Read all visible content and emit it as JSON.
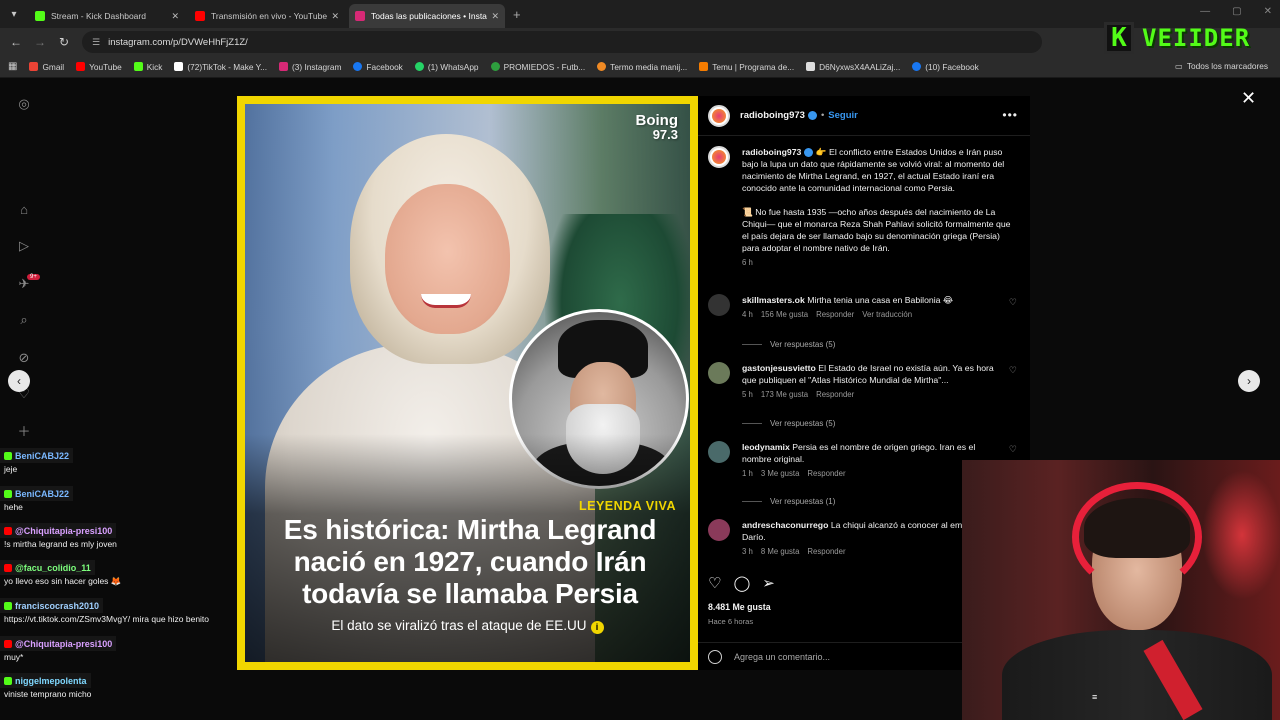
{
  "browser": {
    "tabs": [
      {
        "title": "Stream - Kick Dashboard",
        "color": "#53fc18",
        "active": false
      },
      {
        "title": "Transmisión en vivo - YouTube",
        "color": "#ff0000",
        "active": false
      },
      {
        "title": "Todas las publicaciones • Instag",
        "color": "#d62976",
        "active": true
      }
    ],
    "url": "instagram.com/p/DVWeHhFjZ1Z/",
    "bookmarks": [
      {
        "label": "Gmail",
        "color": "#ea4335"
      },
      {
        "label": "YouTube",
        "color": "#ff0000"
      },
      {
        "label": "Kick",
        "color": "#53fc18"
      },
      {
        "label": "(72)TikTok - Make Y...",
        "color": "#ffffff"
      },
      {
        "label": "(3) Instagram",
        "color": "#d62976"
      },
      {
        "label": "Facebook",
        "color": "#1877f2"
      },
      {
        "label": "(1) WhatsApp",
        "color": "#25d366"
      },
      {
        "label": "PROMIEDOS - Futb...",
        "color": "#2e9e3e"
      },
      {
        "label": "Termo media manij...",
        "color": "#f08a24"
      },
      {
        "label": "Temu | Programa de...",
        "color": "#f57c00"
      },
      {
        "label": "D6NyxwsX4AALiZaj...",
        "color": "#dddddd"
      },
      {
        "label": "(10) Facebook",
        "color": "#1877f2"
      }
    ],
    "all_bookmarks": "Todos los marcadores"
  },
  "kick_logo": {
    "k": "K",
    "name": "VEIIDER"
  },
  "post_image": {
    "brand_line1": "Boing",
    "brand_line2": "97.3",
    "tag": "LEYENDA VIVA",
    "headline": "Es histórica: Mirtha Legrand nació en 1927, cuando Irán todavía se llamaba Persia",
    "subline": "El dato se viralizó tras el ataque de EE.UU"
  },
  "post": {
    "username": "radioboing973",
    "follow": "Seguir",
    "caption_p1": "👉 El conflicto entre Estados Unidos e Irán puso bajo la lupa un dato que rápidamente se volvió viral: al momento del nacimiento de Mirtha Legrand, en 1927, el actual Estado iraní era conocido ante la comunidad internacional como Persia.",
    "caption_p2": "📜 No fue hasta 1935 —ocho años después del nacimiento de La Chiqui— que el monarca Reza Shah Pahlavi solicitó formalmente que el país dejara de ser llamado bajo su denominación griega (Persia) para adoptar el nombre nativo de Irán.",
    "caption_time": "6 h",
    "likes": "8.481 Me gusta",
    "time_ago": "Hace 6 horas",
    "comment_placeholder": "Agrega un comentario..."
  },
  "comments": [
    {
      "user": "skillmasters.ok",
      "text": "Mirtha tenia una casa en Babilonia 😂",
      "time": "4 h",
      "likes": "156 Me gusta",
      "reply": "Responder",
      "extra": "Ver traducción",
      "replies": "Ver respuestas (5)",
      "avatar": "#333333"
    },
    {
      "user": "gastonjesusvietto",
      "text": "El Estado de Israel no existía aún. Ya es hora que publiquen el \"Atlas Histórico Mundial de Mirtha\"...",
      "time": "5 h",
      "likes": "173 Me gusta",
      "reply": "Responder",
      "extra": "",
      "replies": "Ver respuestas (5)",
      "avatar": "#6b7a5a"
    },
    {
      "user": "leodynamix",
      "text": "Persia es el nombre de origen griego. Iran es el nombre original.",
      "time": "1 h",
      "likes": "3 Me gusta",
      "reply": "Responder",
      "extra": "",
      "replies": "Ver respuestas (1)",
      "avatar": "#4a6a6a"
    },
    {
      "user": "andreschaconurrego",
      "text": "La chiqui alcanzó a conocer al emperador Darío.",
      "time": "3 h",
      "likes": "8 Me gusta",
      "reply": "Responder",
      "extra": "",
      "replies": "",
      "avatar": "#8a3a5a"
    }
  ],
  "chat": [
    {
      "name": "BeniCABJ22",
      "msg": "jeje",
      "color": "#7ab8ff"
    },
    {
      "name": "BeniCABJ22",
      "msg": "hehe",
      "color": "#7ab8ff"
    },
    {
      "name": "@Chiquitapia-presi100",
      "msg": "!s mirtha legrand es mly joven",
      "color": "#d9a0ff"
    },
    {
      "name": "@facu_colidio_11",
      "msg": "yo llevo eso sin hacer goles 🦊",
      "color": "#7dff7d"
    },
    {
      "name": "franciscocrash2010",
      "msg": "https://vt.tiktok.com/ZSmv3MvgY/ mira que hizo benito",
      "color": "#a0d0ff"
    },
    {
      "name": "@Chiquitapia-presi100",
      "msg": "muy*",
      "color": "#d9a0ff"
    },
    {
      "name": "niggelmepolenta",
      "msg": "viniste temprano micho",
      "color": "#7fd8ff"
    }
  ]
}
